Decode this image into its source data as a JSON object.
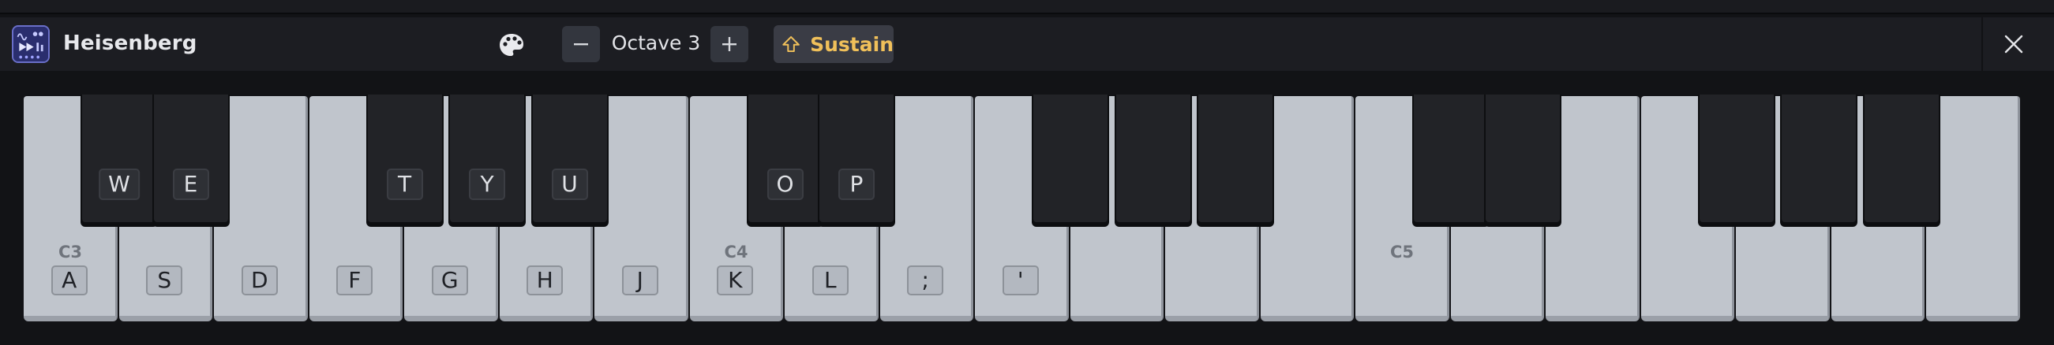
{
  "app": {
    "name": "Heisenberg",
    "icon": "synth-app-icon"
  },
  "toolbar": {
    "palette_icon": "palette-icon",
    "octave_decrement_icon": "minus-icon",
    "octave_label": "Octave 3",
    "octave_increment_icon": "plus-icon",
    "sustain_icon": "shift-arrow-icon",
    "sustain_label": "Sustain",
    "close_icon": "close-icon"
  },
  "colors": {
    "sustain_accent": "#f0c05a",
    "white_key": "#c0c5cc",
    "black_key": "#222327",
    "toolbar_bg": "#1c1d22",
    "page_bg": "#121316"
  },
  "keyboard": {
    "white_keys": [
      {
        "note": "C3",
        "octave_label": "C3",
        "key": "A"
      },
      {
        "note": "D3",
        "octave_label": "",
        "key": "S"
      },
      {
        "note": "E3",
        "octave_label": "",
        "key": "D"
      },
      {
        "note": "F3",
        "octave_label": "",
        "key": "F"
      },
      {
        "note": "G3",
        "octave_label": "",
        "key": "G"
      },
      {
        "note": "A3",
        "octave_label": "",
        "key": "H"
      },
      {
        "note": "B3",
        "octave_label": "",
        "key": "J"
      },
      {
        "note": "C4",
        "octave_label": "C4",
        "key": "K"
      },
      {
        "note": "D4",
        "octave_label": "",
        "key": "L"
      },
      {
        "note": "E4",
        "octave_label": "",
        "key": ";"
      },
      {
        "note": "F4",
        "octave_label": "",
        "key": "'"
      },
      {
        "note": "G4",
        "octave_label": "",
        "key": ""
      },
      {
        "note": "A4",
        "octave_label": "",
        "key": ""
      },
      {
        "note": "B4",
        "octave_label": "",
        "key": ""
      },
      {
        "note": "C5",
        "octave_label": "C5",
        "key": ""
      },
      {
        "note": "D5",
        "octave_label": "",
        "key": ""
      },
      {
        "note": "E5",
        "octave_label": "",
        "key": ""
      },
      {
        "note": "F5",
        "octave_label": "",
        "key": ""
      },
      {
        "note": "G5",
        "octave_label": "",
        "key": ""
      },
      {
        "note": "A5",
        "octave_label": "",
        "key": ""
      },
      {
        "note": "B5",
        "octave_label": "",
        "key": ""
      }
    ],
    "black_keys": [
      {
        "note": "C#3",
        "after_white": 0,
        "key": "W"
      },
      {
        "note": "D#3",
        "after_white": 1,
        "key": "E"
      },
      {
        "note": "F#3",
        "after_white": 3,
        "key": "T"
      },
      {
        "note": "G#3",
        "after_white": 4,
        "key": "Y"
      },
      {
        "note": "A#3",
        "after_white": 5,
        "key": "U"
      },
      {
        "note": "C#4",
        "after_white": 7,
        "key": "O"
      },
      {
        "note": "D#4",
        "after_white": 8,
        "key": "P"
      },
      {
        "note": "F#4",
        "after_white": 10,
        "key": ""
      },
      {
        "note": "G#4",
        "after_white": 11,
        "key": ""
      },
      {
        "note": "A#4",
        "after_white": 12,
        "key": ""
      },
      {
        "note": "C#5",
        "after_white": 14,
        "key": ""
      },
      {
        "note": "D#5",
        "after_white": 15,
        "key": ""
      },
      {
        "note": "F#5",
        "after_white": 17,
        "key": ""
      },
      {
        "note": "G#5",
        "after_white": 18,
        "key": ""
      },
      {
        "note": "A#5",
        "after_white": 19,
        "key": ""
      }
    ]
  }
}
